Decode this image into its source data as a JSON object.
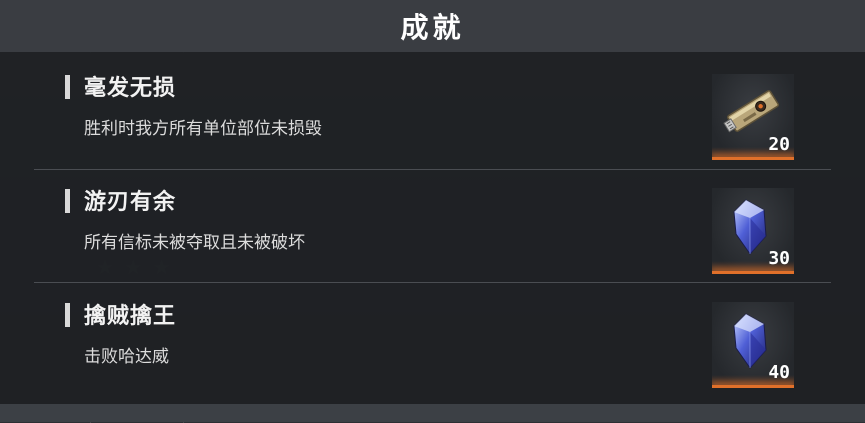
{
  "title": "成就",
  "achievements": [
    {
      "name": "毫发无损",
      "description": "胜利时我方所有单位部位未损毁",
      "reward": {
        "icon": "data-chip-icon",
        "count": "20"
      }
    },
    {
      "name": "游刃有余",
      "description": "所有信标未被夺取且未被破坏",
      "reward": {
        "icon": "crystal-icon",
        "count": "30"
      }
    },
    {
      "name": "擒贼擒王",
      "description": "击败哈达威",
      "reward": {
        "icon": "crystal-icon",
        "count": "40"
      }
    }
  ],
  "colors": {
    "accent": "#e0702a",
    "panel": "#1e2023",
    "title_bar": "#3a3d42"
  }
}
